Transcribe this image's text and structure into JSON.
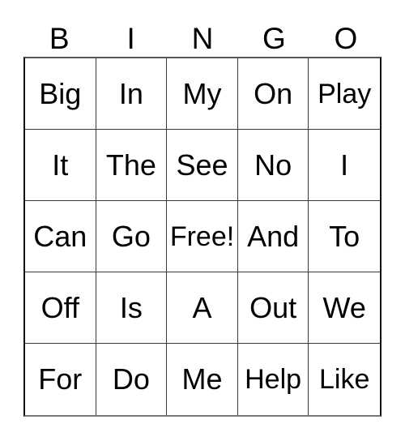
{
  "card": {
    "title_letters": [
      "B",
      "I",
      "N",
      "G",
      "O"
    ],
    "colors": {
      "background": "#ffffff",
      "text": "#000000",
      "grid_line": "#3a3a3a",
      "grid_border": "#111111"
    },
    "rows": [
      {
        "cells": [
          "Big",
          "In",
          "My",
          "On",
          "Play"
        ]
      },
      {
        "cells": [
          "It",
          "The",
          "See",
          "No",
          "I"
        ]
      },
      {
        "cells": [
          "Can",
          "Go",
          "Free!",
          "And",
          "To"
        ]
      },
      {
        "cells": [
          "Off",
          "Is",
          "A",
          "Out",
          "We"
        ]
      },
      {
        "cells": [
          "For",
          "Do",
          "Me",
          "Help",
          "Like"
        ]
      }
    ]
  }
}
